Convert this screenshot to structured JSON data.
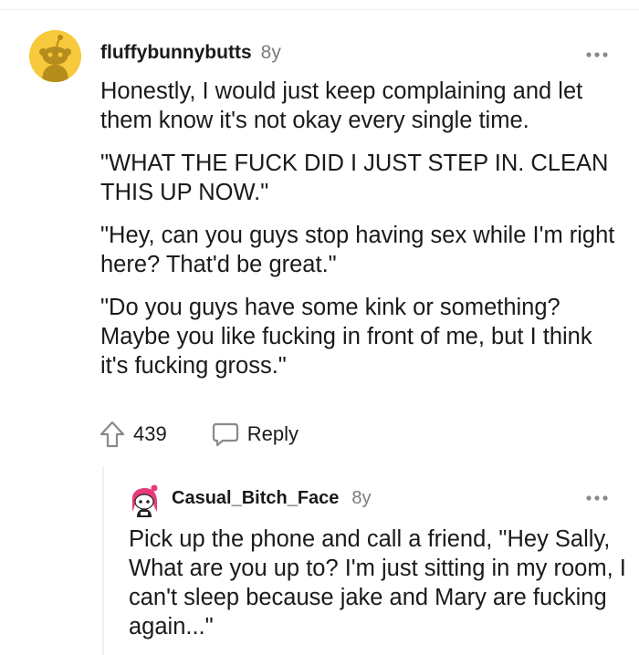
{
  "comment": {
    "author": "fluffybunnybutts",
    "age": "8y",
    "more_icon": "more-dots-icon",
    "paragraphs": [
      "Honestly, I would just keep complaining and let them know it's not okay every single time.",
      "\"WHAT THE FUCK DID I JUST STEP IN. CLEAN THIS UP NOW.\"",
      "\"Hey, can you guys stop having sex while I'm right here? That'd be great.\"",
      "\"Do you guys have some kink or something? Maybe you like fucking in front of me, but I think it's fucking gross.\""
    ],
    "votes": "439",
    "reply_label": "Reply",
    "avatar_color": "#f7c93c"
  },
  "reply": {
    "author": "Casual_Bitch_Face",
    "age": "8y",
    "text": "Pick up the phone and call a friend, \"Hey Sally, What are you up to? I'm just sitting in my room, I can't sleep because jake and Mary are fucking again...\""
  }
}
